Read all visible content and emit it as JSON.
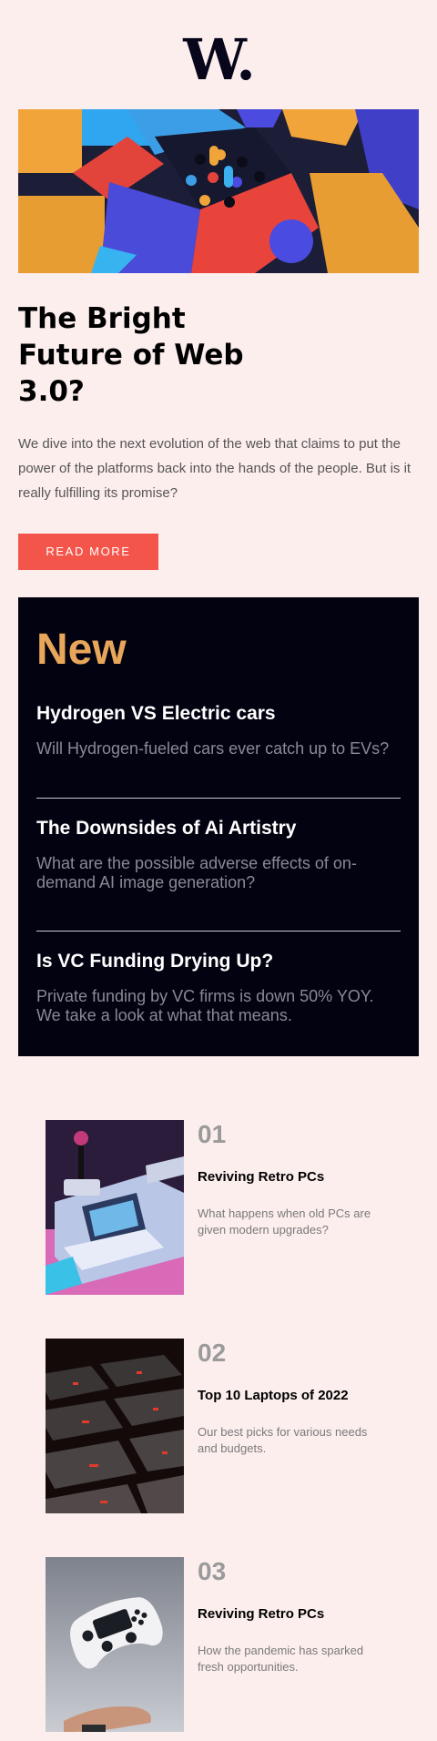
{
  "brand": {
    "logo_text": "W."
  },
  "hero": {
    "title": "The Bright Future of Web 3.0?",
    "description": "We dive into the next evolution of the web that claims to put the power of the platforms back into the hands of the people. But is it really fulfilling its promise?",
    "button_label": "READ MORE"
  },
  "new_section": {
    "heading": "New",
    "items": [
      {
        "title": "Hydrogen VS Electric cars",
        "description": "Will Hydrogen-fueled cars ever catch up to EVs?"
      },
      {
        "title": "The Downsides of Ai Artistry",
        "description": "What are the possible adverse effects of on-demand AI image generation?"
      },
      {
        "title": "Is VC Funding Drying Up?",
        "description": "Private funding by VC firms is down 50% YOY. We take a look at what that means."
      }
    ]
  },
  "articles": [
    {
      "number": "01",
      "title": "Reviving Retro PCs",
      "description": "What happens when old PCs are given modern upgrades?"
    },
    {
      "number": "02",
      "title": "Top 10 Laptops of 2022",
      "description": "Our best picks for various needs and budgets."
    },
    {
      "number": "03",
      "title": "Reviving Retro PCs",
      "description": "How the pandemic has sparked fresh opportunities."
    }
  ],
  "colors": {
    "background": "#fdeeee",
    "accent": "#f4554a",
    "dark_panel": "#030211",
    "new_heading": "#e8a65a"
  }
}
